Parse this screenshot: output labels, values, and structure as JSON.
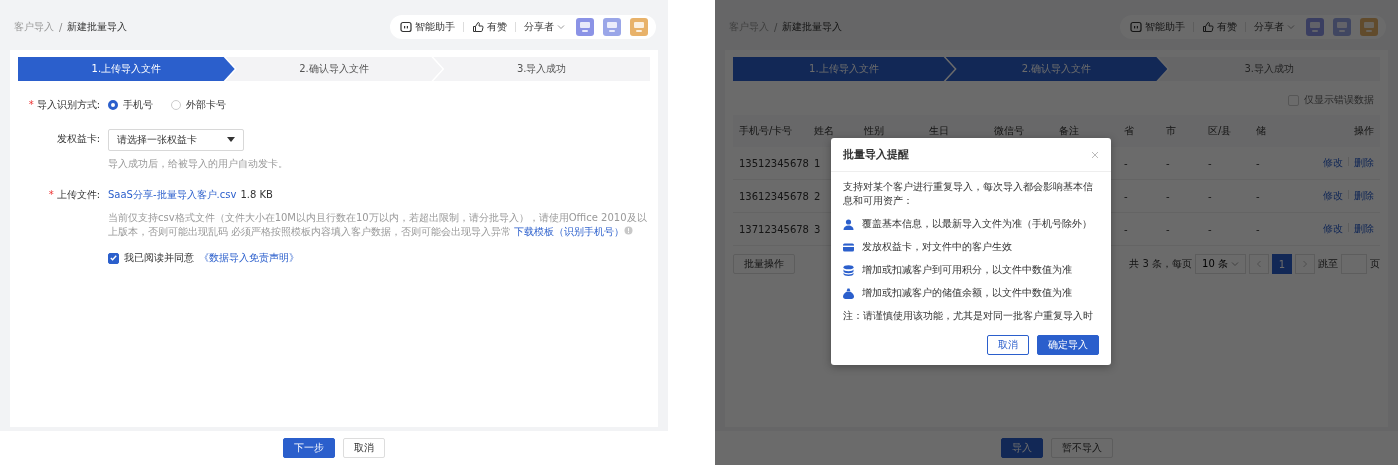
{
  "left": {
    "breadcrumb": [
      "客户导入",
      "新建批量导入"
    ],
    "breadcrumb_separator": "/",
    "required_mark": "*",
    "toolbar": {
      "assistant": "智能助手",
      "like": "有赞",
      "user": "分享者"
    },
    "steps": [
      {
        "label": "1.上传导入文件",
        "reached": true
      },
      {
        "label": "2.确认导入文件",
        "reached": false
      },
      {
        "label": "3.导入成功",
        "reached": false
      }
    ],
    "form": {
      "method": {
        "label": "导入识别方式:",
        "required": true,
        "options": [
          {
            "label": "手机号",
            "selected": true
          },
          {
            "label": "外部卡号",
            "selected": false
          }
        ]
      },
      "card": {
        "label": "发权益卡:",
        "required": false,
        "placeholder": "请选择一张权益卡",
        "hint": "导入成功后，给被导入的用户自动发卡。"
      },
      "upload": {
        "label": "上传文件:",
        "required": true,
        "file_name": "SaaS分享-批量导入客户.csv",
        "file_size": "1.8 KB",
        "description": "当前仅支持csv格式文件（文件大小在10M以内且行数在10万以内，若超出限制，请分批导入），请使用Office 2010及以上版本，否则可能出现乱码 必须严格按照模板内容填入客户数据，否则可能会出现导入异常",
        "template_link": "下载模板（识别手机号）"
      },
      "agreement": {
        "checked": true,
        "text": "我已阅读并同意",
        "link": "《数据导入免责声明》"
      }
    },
    "buttons": [
      {
        "label": "下一步",
        "kind": "primary"
      },
      {
        "label": "取消",
        "kind": "default"
      }
    ]
  },
  "right": {
    "breadcrumb": [
      "客户导入",
      "新建批量导入"
    ],
    "breadcrumb_separator": "/",
    "toolbar": {
      "assistant": "智能助手",
      "like": "有赞",
      "user": "分享者"
    },
    "steps": [
      {
        "label": "1.上传导入文件",
        "reached": true
      },
      {
        "label": "2.确认导入文件",
        "reached": true
      },
      {
        "label": "3.导入成功",
        "reached": false
      }
    ],
    "error_filter": {
      "label": "仅显示错误数据",
      "checked": false
    },
    "table": {
      "columns": [
        "手机号/卡号",
        "姓名",
        "性别",
        "生日",
        "微信号",
        "备注",
        "省",
        "市",
        "区/县",
        "储",
        "操作"
      ],
      "rows": [
        {
          "phone": "13512345678",
          "name": "1",
          "province": "-",
          "city": "-",
          "district": "-",
          "column_10": "-",
          "actions": [
            "修改",
            "删除"
          ]
        },
        {
          "phone": "13612345678",
          "name": "2",
          "province": "-",
          "city": "-",
          "district": "-",
          "column_10": "-",
          "actions": [
            "修改",
            "删除"
          ]
        },
        {
          "phone": "13712345678",
          "name": "3",
          "province": "-",
          "city": "-",
          "district": "-",
          "column_10": "-",
          "actions": [
            "修改",
            "删除"
          ]
        }
      ]
    },
    "batch_button": "批量操作",
    "pagination": {
      "total": "共 3 条，每页",
      "page_size": "10 条",
      "pages": [
        {
          "label": "1",
          "selected": true
        }
      ],
      "jump_label": "跳至",
      "jump_suffix": "页"
    },
    "buttons": [
      {
        "label": "导入",
        "kind": "primary"
      },
      {
        "label": "暂不导入",
        "kind": "default"
      }
    ],
    "dialog": {
      "title": "批量导入提醒",
      "intro": "支持对某个客户进行重复导入，每次导入都会影响基本信息和可用资产：",
      "items": [
        {
          "kind": "person",
          "text": "覆盖基本信息，以最新导入文件为准（手机号除外）"
        },
        {
          "kind": "card",
          "text": "发放权益卡，对文件中的客户生效"
        },
        {
          "kind": "coins",
          "text": "增加或扣减客户到可用积分，以文件中数值为准"
        },
        {
          "kind": "bag",
          "text": "增加或扣减客户的储值余额，以文件中数值为准"
        }
      ],
      "note": "注：请谨慎使用该功能，尤其是对同一批客户重复导入时",
      "buttons": [
        {
          "label": "取消",
          "kind": "default"
        },
        {
          "label": "确定导入",
          "kind": "primary"
        }
      ]
    }
  }
}
